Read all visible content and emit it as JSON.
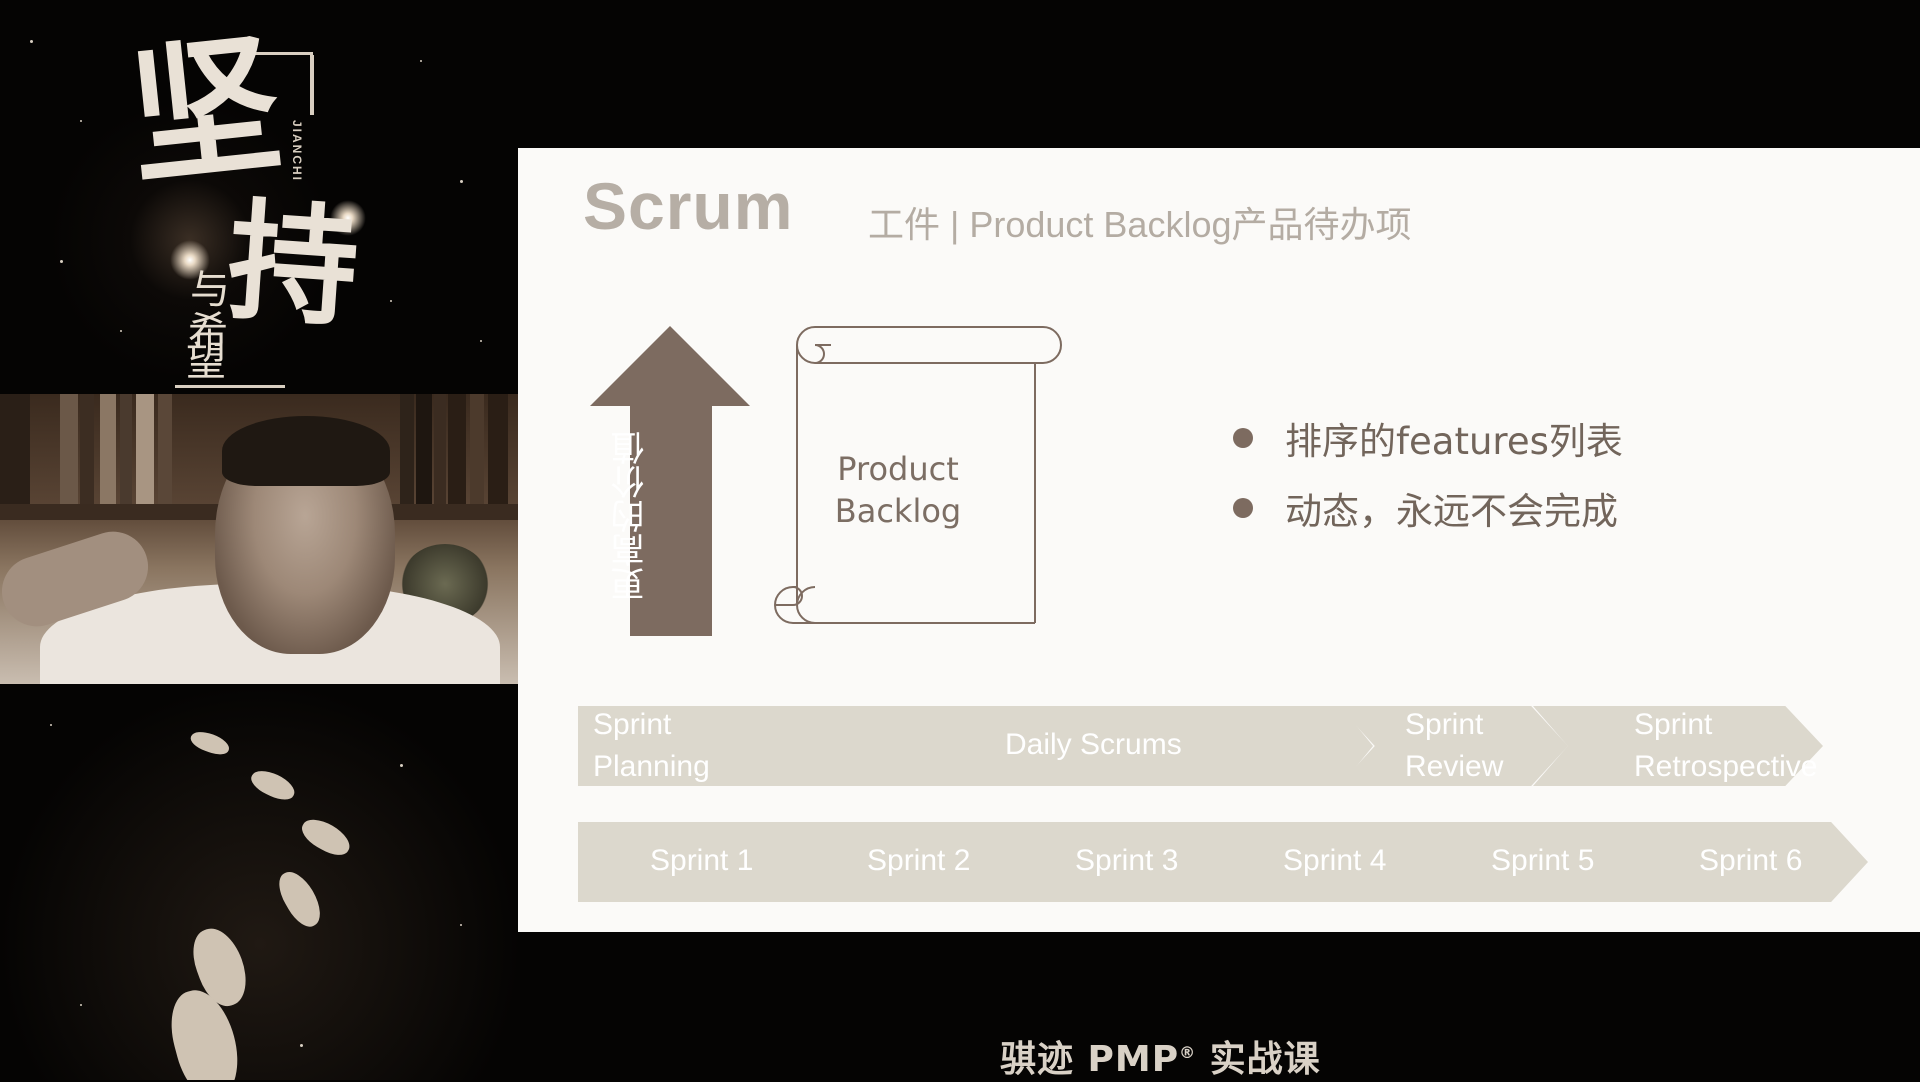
{
  "poster": {
    "main_char_1": "坚",
    "main_char_2": "持",
    "small_chars": [
      "与",
      "希",
      "望"
    ],
    "latin": "JIANCHI"
  },
  "slide": {
    "title": "Scrum",
    "subtitle": "工件 | Product Backlog产品待办项",
    "arrow_label": "更高的价值",
    "scroll_label_line1": "Product",
    "scroll_label_line2": "Backlog",
    "bullets": [
      "排序的features列表",
      "动态，永远不会完成"
    ],
    "phases": [
      {
        "line1": "Sprint",
        "line2": "Planning"
      },
      {
        "line1": "Daily Scrums",
        "line2": ""
      },
      {
        "line1": "Sprint",
        "line2": "Review"
      },
      {
        "line1": "Sprint",
        "line2": "Retrospective"
      }
    ],
    "sprints": [
      "Sprint 1",
      "Sprint 2",
      "Sprint 3",
      "Sprint 4",
      "Sprint 5",
      "Sprint 6"
    ]
  },
  "caption": {
    "text_before": "骐迹 PMP",
    "registered": "®",
    "text_after": " 实战课"
  },
  "colors": {
    "slide_bg": "#fbfaf8",
    "accent_brown": "#7d6b60",
    "chevron_fill": "#dcd8cd",
    "title_gray": "#b6aea5"
  }
}
